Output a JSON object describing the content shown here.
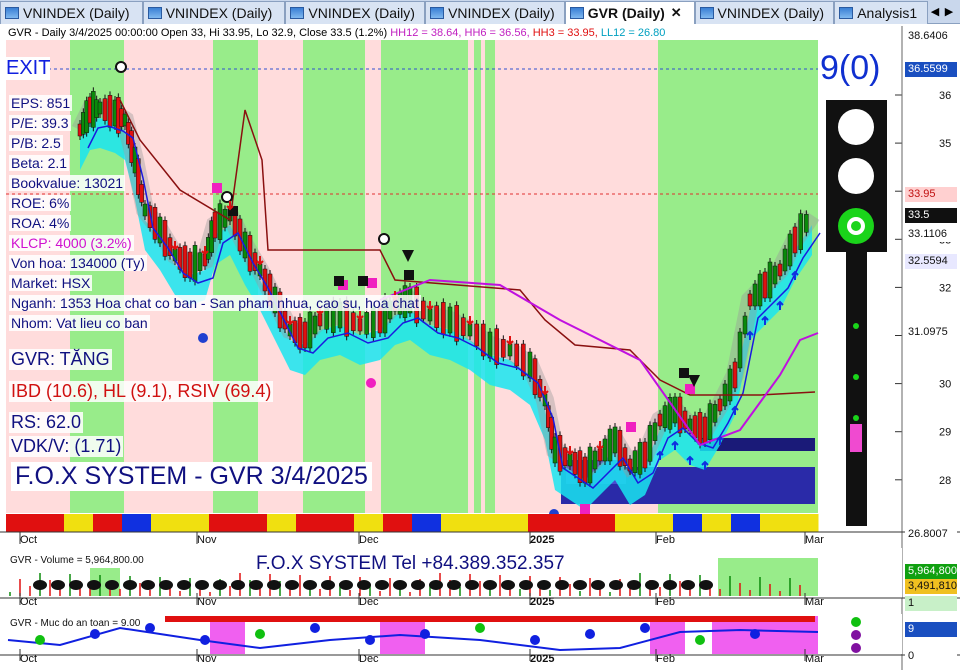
{
  "tabs": [
    {
      "label": "VNINDEX (Daily)",
      "active": false
    },
    {
      "label": "VNINDEX (Daily)",
      "active": false
    },
    {
      "label": "VNINDEX (Daily)",
      "active": false
    },
    {
      "label": "VNINDEX (Daily)",
      "active": false
    },
    {
      "label": "GVR (Daily)",
      "active": true
    },
    {
      "label": "VNINDEX (Daily)",
      "active": false
    },
    {
      "label": "Analysis1",
      "active": false
    }
  ],
  "header": {
    "ohlc": "GVR - Daily 3/4/2025 00:00:00 Open 33, Hi 33.95, Lo 32.9, Close 33.5 (1.2%)",
    "hh12": "HH12 = 38.64,",
    "hh6": "HH6 = 36.56,",
    "hh3": "HH3 = 33.95,",
    "ll12": "LL12 = 26.80"
  },
  "exit": "EXIT",
  "signal": "9(0)",
  "fundamentals": [
    "EPS: 851",
    "P/E: 39.3",
    "P/B: 2.5",
    "Beta: 2.1",
    "Bookvalue: 13021",
    "ROE: 6%",
    "ROA: 4%"
  ],
  "klcp": "KLCP: 4000 (3.2%)",
  "fundamentals2": [
    "Von hoa: 134000 (Ty)",
    "Market: HSX",
    "Nganh: 1353 Hoa chat co ban - San pham nhua, cao su, hoa chat",
    "Nhom: Vat lieu co ban"
  ],
  "status": "GVR: TĂNG",
  "ibd": "IBD (10.6), HL (9.1), RSIV (69.4)",
  "rs": "RS: 62.0",
  "vdk": "VDK/V:  (1.71)",
  "fox": "F.O.X SYSTEM - GVR 3/4/2025",
  "price_labels": [
    {
      "v": "38.6406",
      "bg": "#ffffff",
      "c": "#111"
    },
    {
      "v": "36.5599",
      "bg": "#1a4fc0",
      "c": "#fff"
    },
    {
      "v": "33.95",
      "bg": "#ffd0d0",
      "c": "#c01010"
    },
    {
      "v": "33.5",
      "bg": "#101010",
      "c": "#fff"
    },
    {
      "v": "33.1106",
      "bg": "#ffffff",
      "c": "#111"
    },
    {
      "v": "32.5594",
      "bg": "#e8e8ff",
      "c": "#111"
    },
    {
      "v": "31.0975",
      "bg": "#ffffff",
      "c": "#111"
    },
    {
      "v": "26.8007",
      "bg": "#ffffff",
      "c": "#111"
    }
  ],
  "price_ticks": [
    "36",
    "35",
    "34",
    "33",
    "32",
    "31",
    "30",
    "29",
    "28"
  ],
  "months": [
    "Oct",
    "Nov",
    "Dec",
    "2025",
    "Feb",
    "Mar"
  ],
  "volume_label": "GVR - Volume = 5,964,800.00",
  "volume_value": "5,964,800",
  "volume_value2": "3,491,810",
  "volume_tick": "1",
  "tel": "F.O.X SYSTEM Tel +84.389.352.357",
  "safety_label": "GVR - Muc do an toan = 9.00",
  "safety_value": "9",
  "safety_tick": "0",
  "colors": {
    "green_zone": "#98ec8a",
    "pink_zone": "#ffdcdc",
    "up": "#0a8a0a",
    "down": "#e01010",
    "cyan": "#19e5f0",
    "blue_line": "#1a1ae0",
    "brown_line": "#8a1010",
    "purple_line": "#c010e0"
  }
}
